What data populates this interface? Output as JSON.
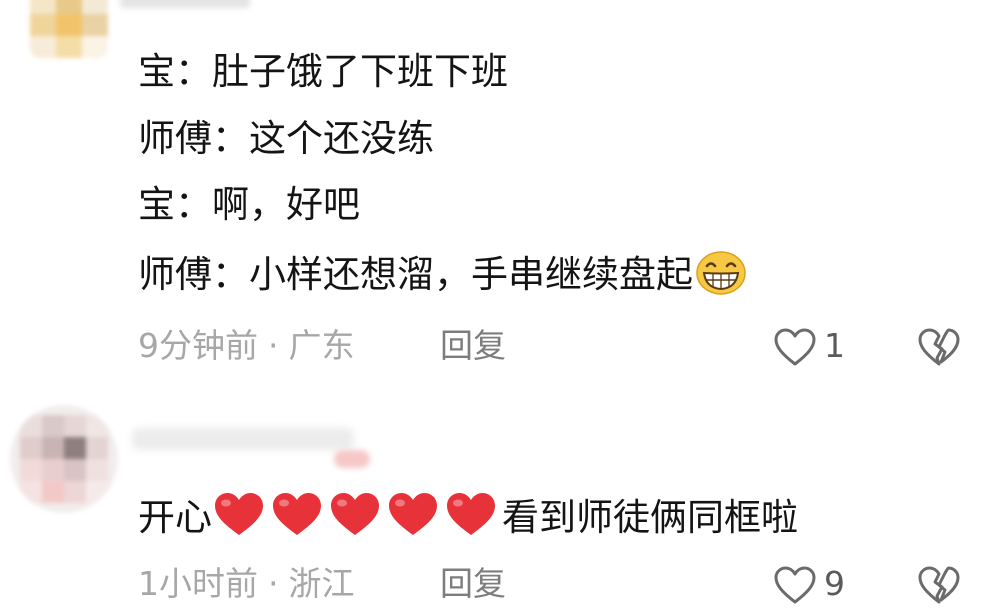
{
  "comment1": {
    "lines": [
      "宝：肚子饿了下班下班",
      "师傅：这个还没练",
      "宝：啊，好吧",
      "师傅：小样还想溜，手串继续盘起"
    ],
    "emoji": "grinning-face-icon",
    "time": "9分钟前",
    "separator": "·",
    "location": "广东",
    "reply_label": "回复",
    "likes": "1"
  },
  "comment2": {
    "text_before": "开心",
    "heart_count": 5,
    "heart_icon": "red-heart-icon",
    "text_after": "看到师徒俩同框啦",
    "time": "1小时前",
    "separator": "·",
    "location": "浙江",
    "reply_label": "回复",
    "likes": "9"
  },
  "colors": {
    "text": "#141414",
    "meta": "#a7a7a7",
    "reply": "#7d7d7d",
    "heart": "#e8323a"
  }
}
